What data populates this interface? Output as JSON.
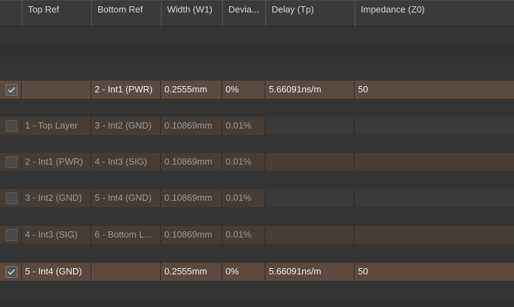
{
  "columns": [
    "",
    "Top Ref",
    "Bottom Ref",
    "Width (W1)",
    "Devia...",
    "Delay (Tp)",
    "Impedance (Z0)"
  ],
  "rows": [
    {
      "checked": true,
      "top_ref": "",
      "bottom_ref": "2 - Int1 (PWR)",
      "width": "0.2555mm",
      "deviation": "0%",
      "delay": "5.66091ns/m",
      "impedance": "50"
    },
    {
      "checked": false,
      "top_ref": "1 - Top Layer",
      "bottom_ref": "3 - Int2 (GND)",
      "width": "0.10869mm",
      "deviation": "0.01%",
      "delay": "",
      "impedance": ""
    },
    {
      "checked": false,
      "top_ref": "2 - Int1 (PWR)",
      "bottom_ref": "4 - Int3 (SIG)",
      "width": "0.10869mm",
      "deviation": "0.01%",
      "delay": "",
      "impedance": ""
    },
    {
      "checked": false,
      "top_ref": "3 - Int2 (GND)",
      "bottom_ref": "5 - Int4 (GND)",
      "width": "0.10869mm",
      "deviation": "0.01%",
      "delay": "",
      "impedance": ""
    },
    {
      "checked": false,
      "top_ref": "4 - Int3 (SIG)",
      "bottom_ref": "6 - Bottom L...",
      "width": "0.10869mm",
      "deviation": "0.01%",
      "delay": "",
      "impedance": ""
    },
    {
      "checked": true,
      "top_ref": "5 - Int4 (GND)",
      "bottom_ref": "",
      "width": "0.2555mm",
      "deviation": "0%",
      "delay": "5.66091ns/m",
      "impedance": "50"
    }
  ],
  "icons": {
    "checkbox": "checkmark-icon"
  },
  "colors": {
    "selected_row": "#5b4a3f",
    "dim_row": "#463d37",
    "header": "#3a3a3a"
  }
}
